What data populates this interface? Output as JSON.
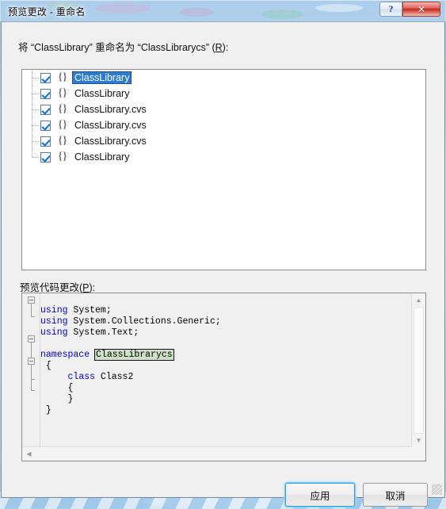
{
  "window": {
    "title": "预览更改 - 重命名",
    "caption_buttons": [
      {
        "name": "help-button",
        "label": "?"
      },
      {
        "name": "close-button",
        "label": "✕"
      }
    ]
  },
  "prompt": {
    "before": "将 “ClassLibrary” 重命名为 “ClassLibrarycs” (",
    "accelerator": "R",
    "after": "):"
  },
  "tree": {
    "items": [
      {
        "label": "ClassLibrary",
        "icon": "{}",
        "checked": true,
        "selected": true
      },
      {
        "label": "ClassLibrary",
        "icon": "{}",
        "checked": true,
        "selected": false
      },
      {
        "label": "ClassLibrary.cvs",
        "icon": "{}",
        "checked": true,
        "selected": false
      },
      {
        "label": "ClassLibrary.cvs",
        "icon": "{}",
        "checked": true,
        "selected": false
      },
      {
        "label": "ClassLibrary.cvs",
        "icon": "{}",
        "checked": true,
        "selected": false
      },
      {
        "label": "ClassLibrary",
        "icon": "{}",
        "checked": true,
        "selected": false
      }
    ]
  },
  "code_label": {
    "before": "预览代码更改(",
    "accelerator": "P",
    "after": "):"
  },
  "code": {
    "lines": [
      {
        "kw": "using",
        "rest": " System;"
      },
      {
        "kw": "using",
        "rest": " System.Collections.Generic;"
      },
      {
        "kw": "using",
        "rest": " System.Text;"
      },
      {
        "kw": "",
        "rest": ""
      },
      {
        "kw": "namespace",
        "rest": " ",
        "highlight": "ClassLibrarycs"
      },
      {
        "kw": "",
        "rest": " {"
      },
      {
        "kw": "",
        "rest": "     ",
        "kw2": "class",
        "rest2": " Class2"
      },
      {
        "kw": "",
        "rest": "     {"
      },
      {
        "kw": "",
        "rest": "     }"
      },
      {
        "kw": "",
        "rest": " }"
      }
    ],
    "highlight_color": "#cfe0c8",
    "keyword_color": "#0000d8"
  },
  "scrollbars": {
    "vertical": {
      "up": "▲",
      "down": "▼"
    },
    "horizontal": {
      "left": "◀"
    }
  },
  "footer": {
    "apply_label": "应用",
    "cancel_label": "取消"
  }
}
